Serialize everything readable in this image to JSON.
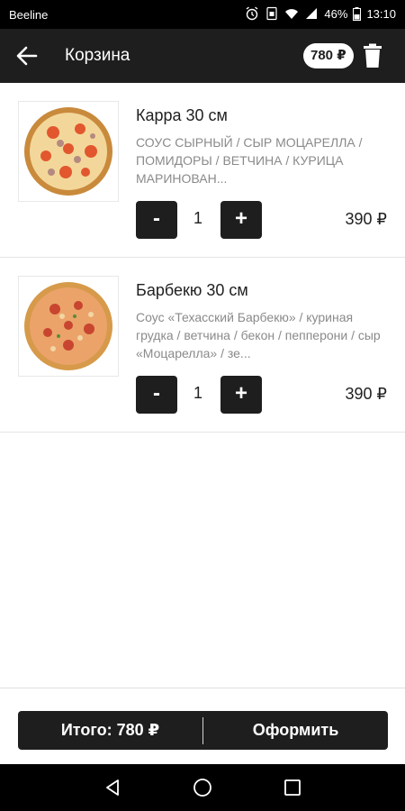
{
  "status_bar": {
    "carrier": "Beeline",
    "battery": "46%",
    "time": "13:10"
  },
  "header": {
    "title": "Корзина",
    "cart_total": "780 ₽"
  },
  "items": [
    {
      "title": "Карра 30 см",
      "description": "СОУС СЫРНЫЙ / СЫР МОЦАРЕЛЛА  / ПОМИДОРЫ / ВЕТЧИНА / КУРИЦА МАРИНОВАН...",
      "quantity": "1",
      "price": "390 ₽",
      "minus_label": "-",
      "plus_label": "+"
    },
    {
      "title": "Барбекю 30 см",
      "description": "Соус «Техасский Барбекю» / куриная грудка / ветчина / бекон / пепперони / сыр «Моцарелла» / зе...",
      "quantity": "1",
      "price": "390 ₽",
      "minus_label": "-",
      "plus_label": "+"
    }
  ],
  "checkout": {
    "total_label": "Итого: 780 ₽",
    "button_label": "Оформить"
  },
  "colors": {
    "bar": "#1e1e1e",
    "status": "#000000",
    "muted_text": "#8a8a8a"
  }
}
